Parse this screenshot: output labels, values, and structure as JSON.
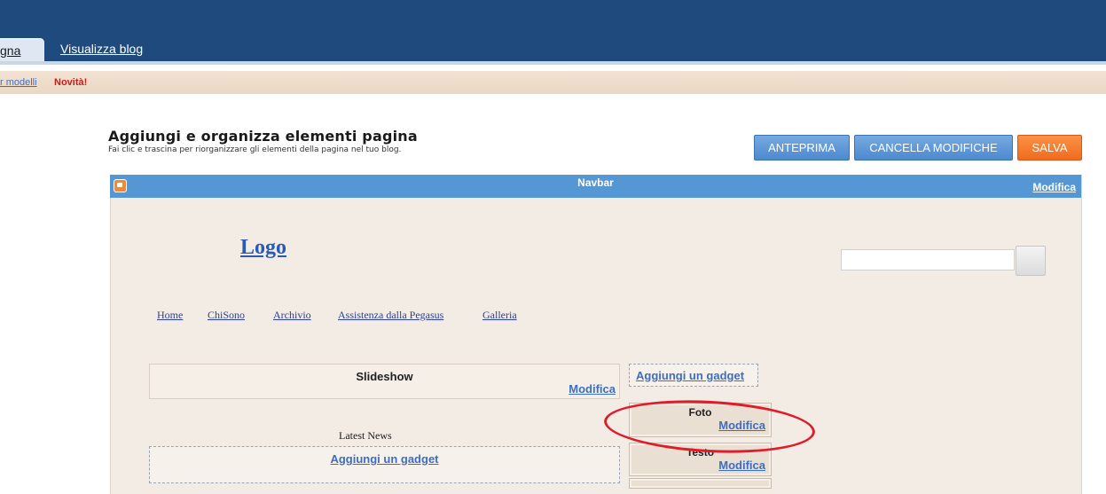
{
  "tabs": {
    "active": "gna",
    "view_blog": "Visualizza blog"
  },
  "notice": {
    "link": "r modelli",
    "new_label": "Novità!"
  },
  "header": {
    "title": "Aggiungi e organizza elementi pagina",
    "subtitle": "Fai clic e trascina per riorganizzare gli elementi della pagina nel tuo blog."
  },
  "buttons": {
    "preview": "ANTEPRIMA",
    "clear": "CANCELLA MODIFICHE",
    "save": "SALVA"
  },
  "navbar": {
    "title": "Navbar",
    "edit": "Modifica"
  },
  "blog": {
    "logo": "Logo",
    "search_value": "",
    "nav_links": [
      "Home",
      "ChiSono",
      "Archivio",
      "Assistenza dalla Pegasus",
      "Galleria"
    ]
  },
  "slideshow": {
    "title": "Slideshow",
    "edit": "Modifica"
  },
  "sidebar": {
    "add_gadget": "Aggiungi un gadget",
    "gadgets": [
      {
        "title": "Foto",
        "edit": "Modifica"
      },
      {
        "title": "Testo",
        "edit": "Modifica"
      }
    ]
  },
  "main": {
    "latest_news": "Latest News",
    "add_gadget": "Aggiungi un gadget"
  },
  "colors": {
    "header_blue": "#1f4a7d",
    "accent_blue": "#5597d4",
    "save_orange": "#f06b1e",
    "highlight_red": "#e01b2a"
  }
}
